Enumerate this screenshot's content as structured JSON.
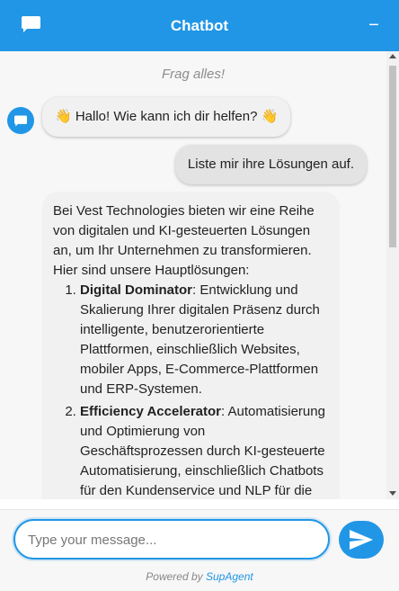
{
  "header": {
    "title": "Chatbot",
    "minimize_label": "−"
  },
  "chat": {
    "hint": "Frag alles!",
    "greeting": "👋 Hallo! Wie kann ich dir helfen? 👋",
    "user_message": "Liste mir ihre Lösungen auf.",
    "answer": {
      "intro": "Bei Vest Technologies bieten wir eine Reihe von digitalen und KI-gesteuerten Lösungen an, um Ihr Unternehmen zu transformieren. Hier sind unsere Hauptlösungen:",
      "items": [
        {
          "name": "Digital Dominator",
          "text": ": Entwicklung und Skalierung Ihrer digitalen Präsenz durch intelligente, benutzerorientierte Plattformen, einschließlich Websites, mobiler Apps, E-Commerce-Plattformen und ERP-Systemen."
        },
        {
          "name": "Efficiency Accelerator",
          "text": ": Automatisierung und Optimierung von Geschäftsprozessen durch KI-gesteuerte Automatisierung, einschließlich Chatbots für den Kundenservice und NLP für die"
        }
      ]
    }
  },
  "composer": {
    "placeholder": "Type your message..."
  },
  "footer": {
    "powered_prefix": "Powered by ",
    "brand": "SupAgent"
  },
  "colors": {
    "accent": "#2196e6"
  }
}
